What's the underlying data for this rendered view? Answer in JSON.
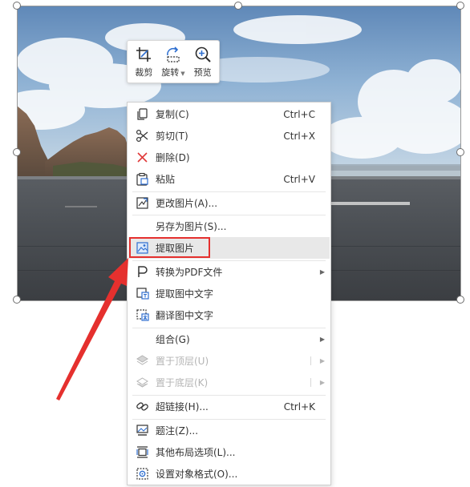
{
  "toolbar": {
    "crop_label": "裁剪",
    "rotate_label": "旋转",
    "preview_label": "预览"
  },
  "menu": {
    "copy": {
      "label": "复制(C)",
      "shortcut": "Ctrl+C",
      "icon": "copy-icon"
    },
    "cut": {
      "label": "剪切(T)",
      "shortcut": "Ctrl+X",
      "icon": "scissors-icon"
    },
    "delete": {
      "label": "删除(D)",
      "icon": "delete-x-icon"
    },
    "paste": {
      "label": "粘贴",
      "shortcut": "Ctrl+V",
      "icon": "clipboard-icon"
    },
    "change_picture": {
      "label": "更改图片(A)...",
      "icon": "change-picture-icon"
    },
    "save_as_picture": {
      "label": "另存为图片(S)..."
    },
    "extract_picture": {
      "label": "提取图片",
      "icon": "extract-picture-icon"
    },
    "convert_pdf": {
      "label": "转换为PDF文件",
      "icon": "pdf-convert-icon"
    },
    "extract_text": {
      "label": "提取图中文字",
      "icon": "ocr-text-icon"
    },
    "translate_text": {
      "label": "翻译图中文字",
      "icon": "translate-icon"
    },
    "group": {
      "label": "组合(G)"
    },
    "bring_to_top": {
      "label": "置于顶层(U)",
      "icon": "bring-to-front-icon"
    },
    "send_to_bottom": {
      "label": "置于底层(K)",
      "icon": "send-to-back-icon"
    },
    "hyperlink": {
      "label": "超链接(H)...",
      "shortcut": "Ctrl+K",
      "icon": "link-icon"
    },
    "caption": {
      "label": "题注(Z)...",
      "icon": "caption-icon"
    },
    "layout_options": {
      "label": "其他布局选项(L)...",
      "icon": "layout-icon"
    },
    "format_object": {
      "label": "设置对象格式(O)...",
      "icon": "format-object-icon"
    }
  },
  "colors": {
    "highlight_border": "#e5302e",
    "annotation_arrow": "#e5302e",
    "menu_icon_blue": "#2f6fd0",
    "disabled_text": "#b4b4b4"
  }
}
